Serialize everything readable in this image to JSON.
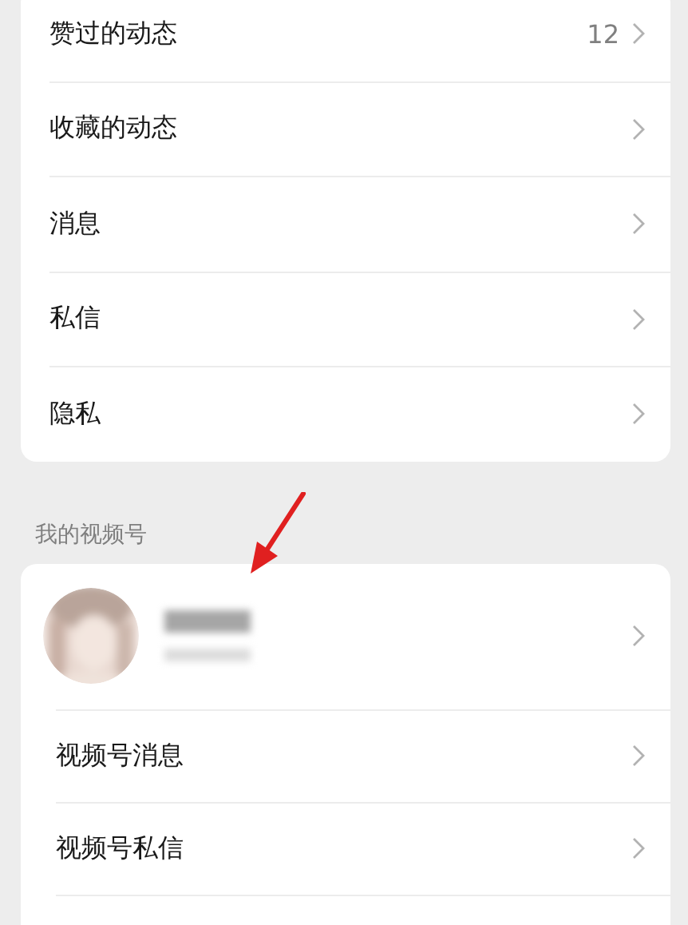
{
  "sections": [
    {
      "items": [
        {
          "label": "赞过的动态",
          "count": "12"
        },
        {
          "label": "收藏的动态"
        },
        {
          "label": "消息"
        },
        {
          "label": "私信"
        },
        {
          "label": "隐私"
        }
      ]
    },
    {
      "header": "我的视频号",
      "items": [
        {
          "label": "视频号消息"
        },
        {
          "label": "视频号私信"
        }
      ]
    }
  ],
  "annotation": {
    "kind": "arrow",
    "color": "#e02020"
  }
}
